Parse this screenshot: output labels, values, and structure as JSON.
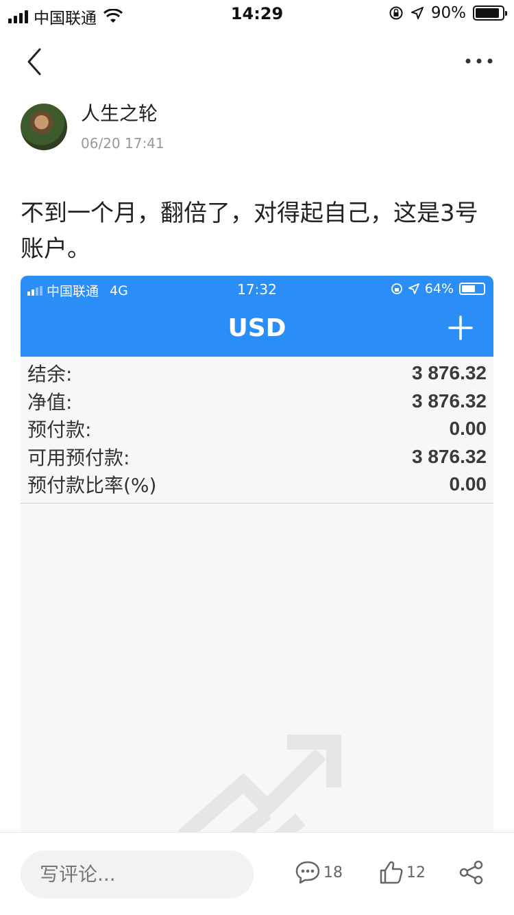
{
  "status_bar": {
    "carrier": "中国联通",
    "time": "14:29",
    "battery_percent": "90%",
    "battery_level": 0.9
  },
  "nav": {
    "back_icon": "chevron-left-icon",
    "more_icon": "ellipsis-icon"
  },
  "author": {
    "name": "人生之轮",
    "time": "06/20 17:41"
  },
  "post": {
    "text": "不到一个月，翻倍了，对得起自己，这是3号账户。"
  },
  "embedded_screenshot": {
    "status_bar": {
      "carrier": "中国联通",
      "network": "4G",
      "time": "17:32",
      "battery_percent": "64%",
      "battery_level": 0.64
    },
    "title": "USD",
    "rows": [
      {
        "label": "结余:",
        "value": "3 876.32"
      },
      {
        "label": "净值:",
        "value": "3 876.32"
      },
      {
        "label": "预付款:",
        "value": "0.00"
      },
      {
        "label": "可用预付款:",
        "value": "3 876.32"
      },
      {
        "label": "预付款比率(%)",
        "value": "0.00"
      }
    ],
    "accent_color": "#2b8ef6"
  },
  "bottom_bar": {
    "comment_placeholder": "写评论...",
    "comment_count": "18",
    "like_count": "12"
  }
}
